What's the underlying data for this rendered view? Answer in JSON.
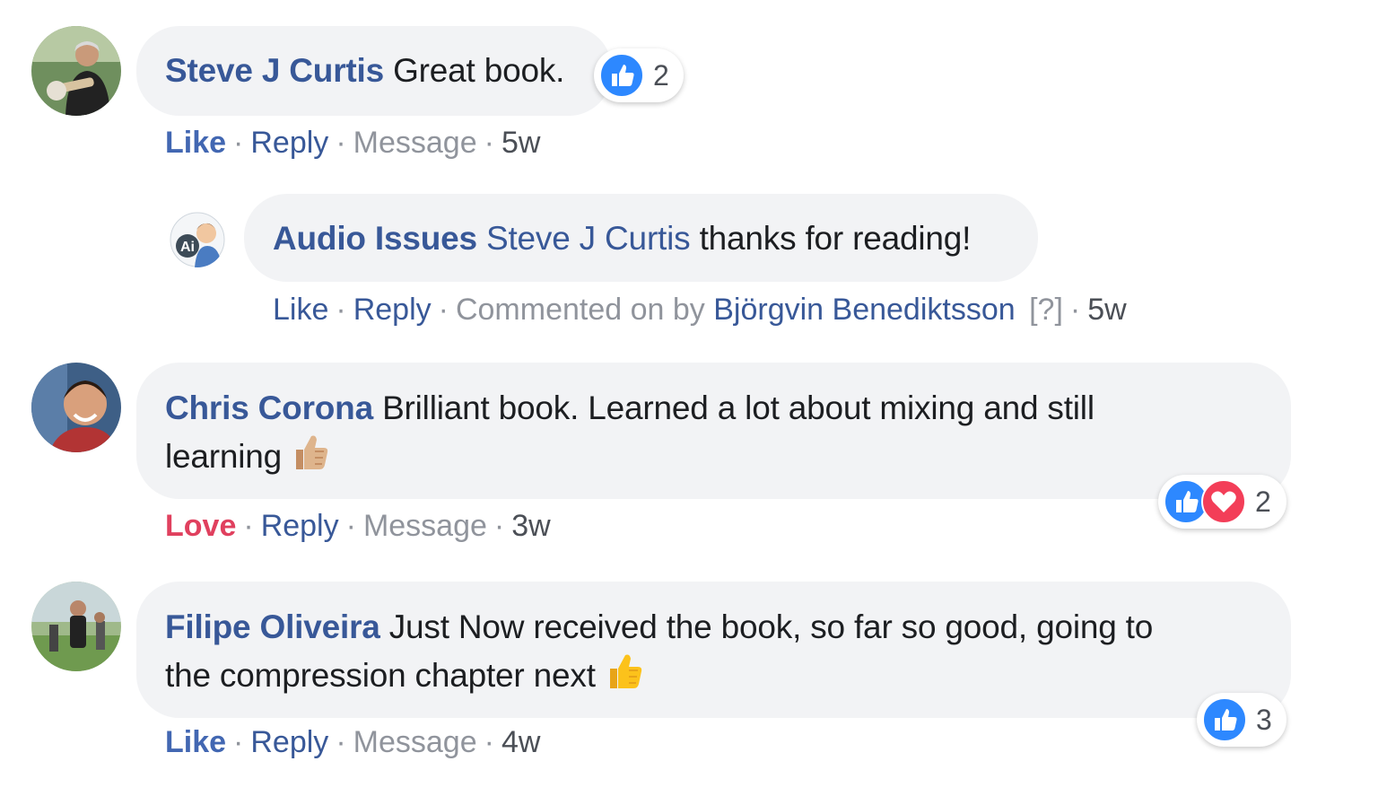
{
  "comments": [
    {
      "author": "Steve J Curtis",
      "text": "Great book.",
      "actions": {
        "like": "Like",
        "reply": "Reply",
        "message": "Message",
        "time": "5w",
        "sep": "·"
      },
      "reactions": {
        "count": "2",
        "icons": [
          "like-reaction-icon"
        ]
      }
    },
    {
      "author": "Audio Issues",
      "mention": "Steve J Curtis",
      "text": "thanks for reading!",
      "actions": {
        "like": "Like",
        "reply": "Reply",
        "commented_on_by": "Commented on by",
        "commenter": "Björgvin Benediktsson",
        "help": "[?]",
        "time": "5w",
        "sep": "·"
      }
    },
    {
      "author": "Chris Corona",
      "text_line1": "Brilliant book. Learned a lot about mixing and still",
      "text_line2": "learning",
      "emoji": "thumbs-up-medium-skin-icon",
      "actions": {
        "love": "Love",
        "reply": "Reply",
        "message": "Message",
        "time": "3w",
        "sep": "·"
      },
      "reactions": {
        "count": "2",
        "icons": [
          "like-reaction-icon",
          "love-reaction-icon"
        ]
      }
    },
    {
      "author": "Filipe Oliveira",
      "text_line1": "Just Now received the book, so far so good, going to",
      "text_line2": "the compression chapter next",
      "emoji": "thumbs-up-yellow-icon",
      "actions": {
        "like": "Like",
        "reply": "Reply",
        "message": "Message",
        "time": "4w",
        "sep": "·"
      },
      "reactions": {
        "count": "3",
        "icons": [
          "like-reaction-icon"
        ]
      }
    }
  ],
  "colors": {
    "author": "#385898",
    "bubble": "#f2f3f5",
    "like_blue": "#4267b2",
    "love_red": "#e0405e",
    "meta_grey": "#90949c"
  }
}
